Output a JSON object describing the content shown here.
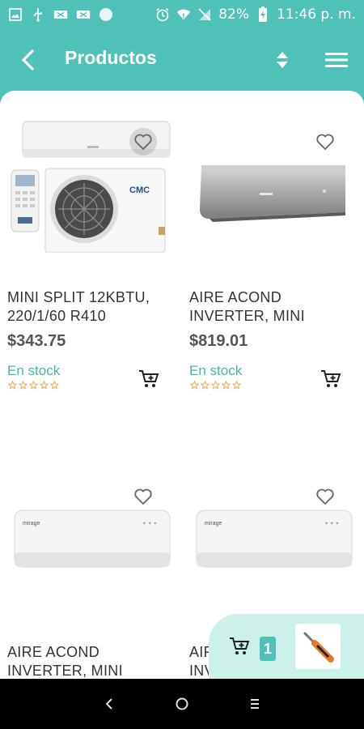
{
  "status_bar": {
    "battery": "82%",
    "time": "11:46 p. m."
  },
  "app_bar": {
    "title": "Productos"
  },
  "products": [
    {
      "name_line1": "MINI SPLIT 12KBTU,",
      "name_line2": "220/1/60 R410",
      "price": "$343.75",
      "stock": "En stock",
      "rating": 0
    },
    {
      "name_line1": "AIRE ACOND",
      "name_line2": "INVERTER, MINI",
      "price": "$819.01",
      "stock": "En stock",
      "rating": 0
    },
    {
      "name_line1": "AIRE ACOND",
      "name_line2": "INVERTER, MINI"
    },
    {
      "name_line1": "AIRE ACOND",
      "name_line2": "INVERTER, MINI"
    }
  ],
  "cart": {
    "count": "1"
  },
  "colors": {
    "brand": "#4fc1b6",
    "stock": "#43b8a5",
    "star": "#e8a33d",
    "cart_panel": "#ccf0ea"
  }
}
